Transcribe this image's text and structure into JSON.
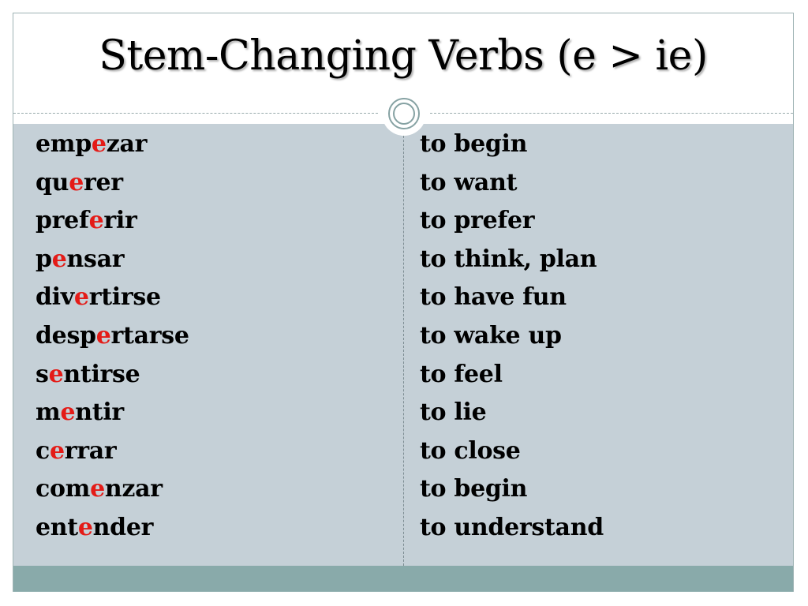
{
  "slide": {
    "title": "Stem-Changing Verbs (e > ie)",
    "highlight_color": "#e41b17",
    "verbs": [
      {
        "before": "emp",
        "highlight": "e",
        "after": "zar",
        "meaning": "to begin"
      },
      {
        "before": "qu",
        "highlight": "e",
        "after": "rer",
        "meaning": "to want"
      },
      {
        "before": "pref",
        "highlight": "e",
        "after": "rir",
        "meaning": "to prefer"
      },
      {
        "before": "p",
        "highlight": "e",
        "after": "nsar",
        "meaning": "to think, plan"
      },
      {
        "before": "div",
        "highlight": "e",
        "after": "rtirse",
        "meaning": "to have fun"
      },
      {
        "before": "desp",
        "highlight": "e",
        "after": "rtarse",
        "meaning": "to wake up"
      },
      {
        "before": "s",
        "highlight": "e",
        "after": "ntirse",
        "meaning": "to feel"
      },
      {
        "before": "m",
        "highlight": "e",
        "after": "ntir",
        "meaning": "to lie"
      },
      {
        "before": "c",
        "highlight": "e",
        "after": "rrar",
        "meaning": "to close"
      },
      {
        "before": "com",
        "highlight": "e",
        "after": "nzar",
        "meaning": "to begin"
      },
      {
        "before": "ent",
        "highlight": "e",
        "after": "nder",
        "meaning": "to understand"
      }
    ]
  }
}
